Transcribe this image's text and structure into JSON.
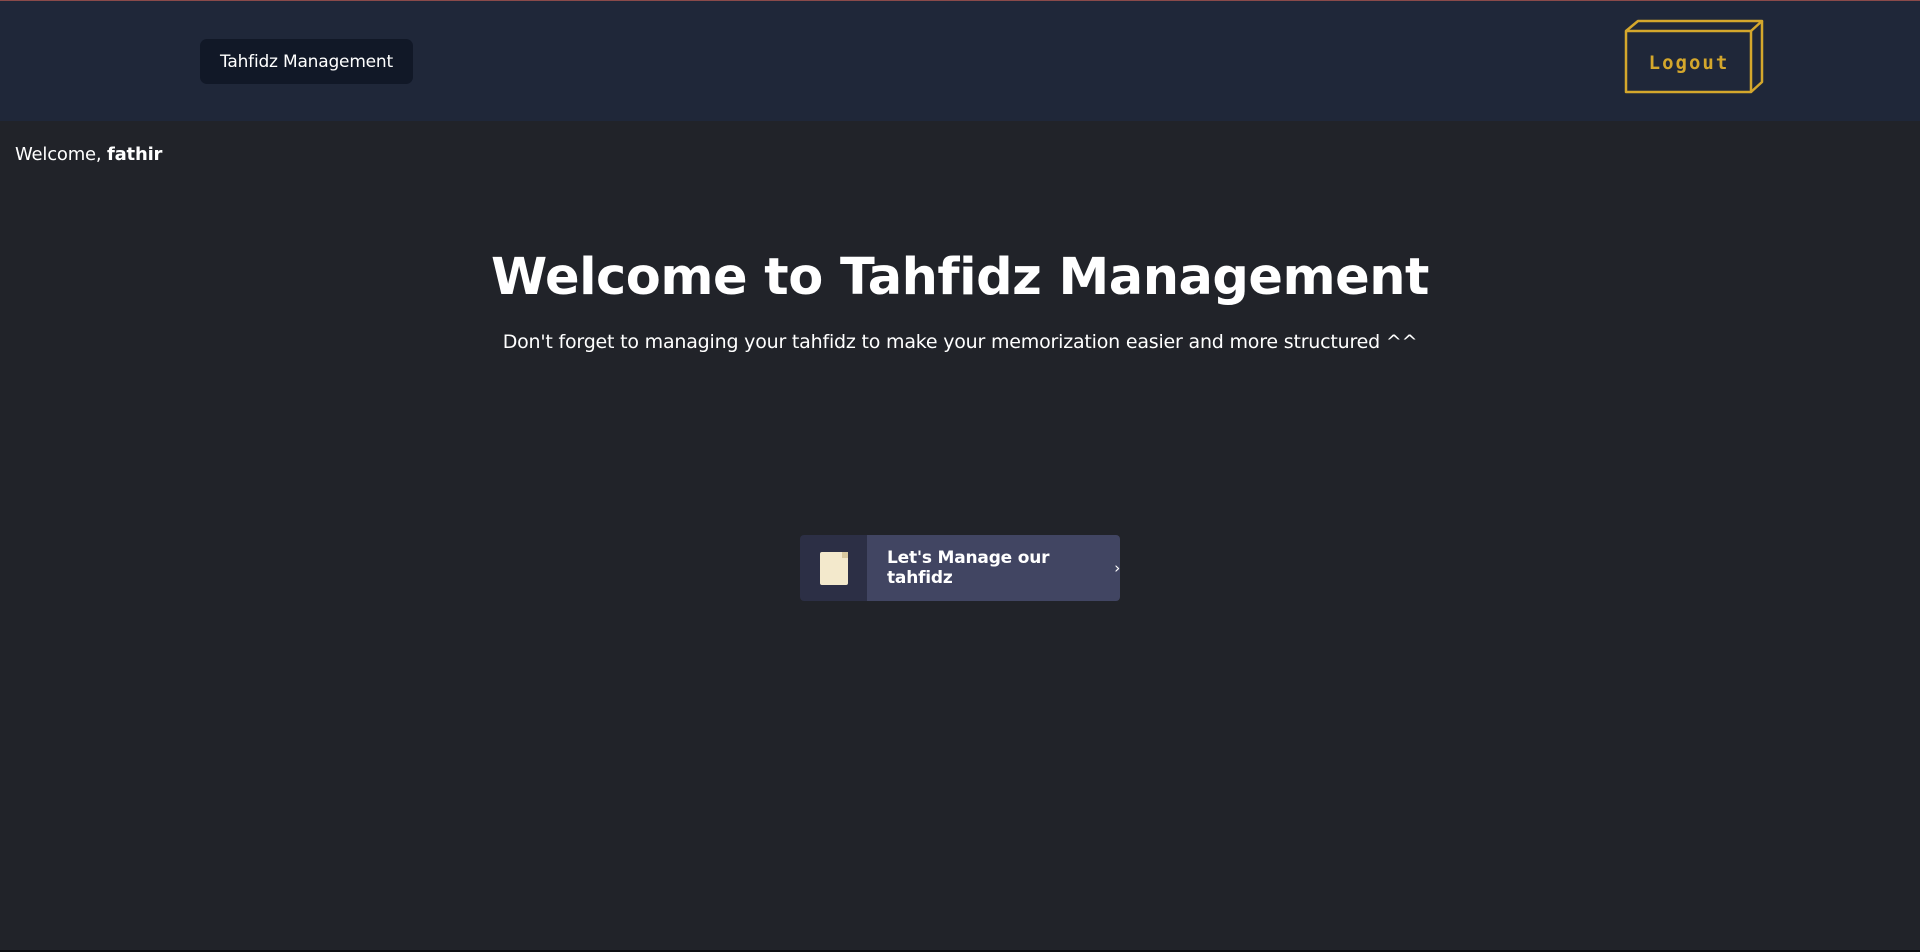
{
  "navbar": {
    "brand": "Tahfidz Management",
    "logout_label": "Logout"
  },
  "greeting": {
    "prefix": "Welcome, ",
    "username": "fathir"
  },
  "hero": {
    "title": "Welcome to Tahfidz Management",
    "subtitle": "Don't forget to managing your tahfidz to make your memorization easier and more structured ^^"
  },
  "cta": {
    "label": "Let's Manage our tahfidz",
    "chevron": "›",
    "icon": "note-icon"
  },
  "colors": {
    "background": "#212329",
    "navbar": "#1f2739",
    "brand_bg": "#111827",
    "logout_accent": "#d4a72c",
    "cta_bg": "#414562",
    "cta_icon_bg": "#2c2f45",
    "cta_icon": "#f3e9cc"
  }
}
